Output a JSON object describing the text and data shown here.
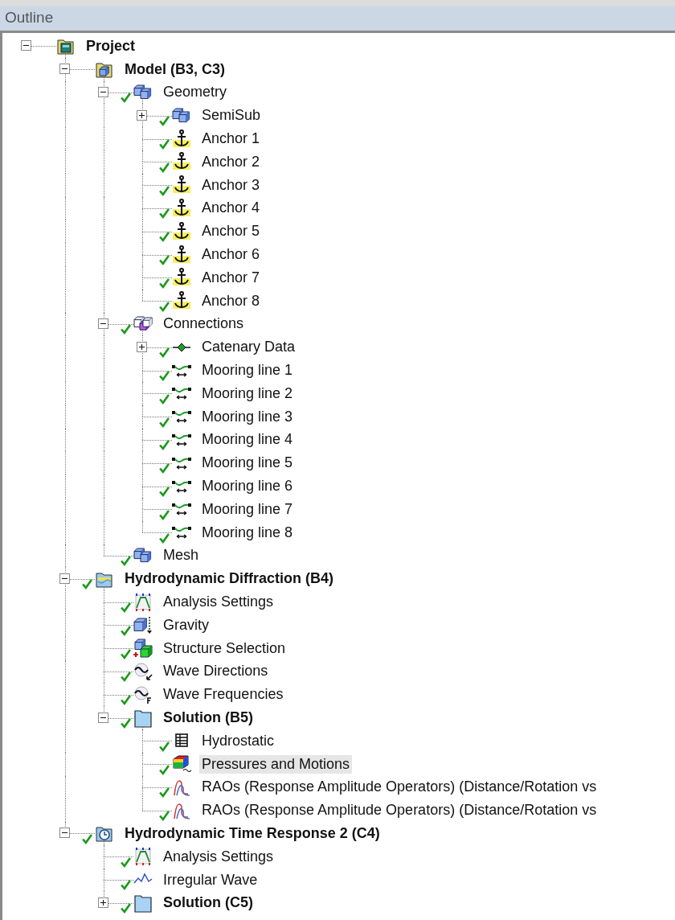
{
  "panel": {
    "title": "Outline"
  },
  "tree": [
    {
      "label": "Project",
      "kind": "project",
      "bold": true,
      "checked": false,
      "selected": false,
      "expanded": true,
      "children": [
        {
          "label": "Model (B3, C3)",
          "kind": "model",
          "bold": true,
          "checked": false,
          "selected": false,
          "expanded": true,
          "children": [
            {
              "label": "Geometry",
              "kind": "geometry",
              "bold": false,
              "checked": true,
              "selected": false,
              "expanded": true,
              "children": [
                {
                  "label": "SemiSub",
                  "kind": "geometry",
                  "bold": false,
                  "checked": true,
                  "selected": false,
                  "expanded": false
                },
                {
                  "label": "Anchor 1",
                  "kind": "anchor",
                  "bold": false,
                  "checked": true,
                  "selected": false
                },
                {
                  "label": "Anchor 2",
                  "kind": "anchor",
                  "bold": false,
                  "checked": true,
                  "selected": false
                },
                {
                  "label": "Anchor 3",
                  "kind": "anchor",
                  "bold": false,
                  "checked": true,
                  "selected": false
                },
                {
                  "label": "Anchor 4",
                  "kind": "anchor",
                  "bold": false,
                  "checked": true,
                  "selected": false
                },
                {
                  "label": "Anchor 5",
                  "kind": "anchor",
                  "bold": false,
                  "checked": true,
                  "selected": false
                },
                {
                  "label": "Anchor 6",
                  "kind": "anchor",
                  "bold": false,
                  "checked": true,
                  "selected": false
                },
                {
                  "label": "Anchor 7",
                  "kind": "anchor",
                  "bold": false,
                  "checked": true,
                  "selected": false
                },
                {
                  "label": "Anchor 8",
                  "kind": "anchor",
                  "bold": false,
                  "checked": true,
                  "selected": false
                }
              ]
            },
            {
              "label": "Connections",
              "kind": "connections",
              "bold": false,
              "checked": true,
              "selected": false,
              "expanded": true,
              "children": [
                {
                  "label": "Catenary Data",
                  "kind": "catenary",
                  "bold": false,
                  "checked": true,
                  "selected": false,
                  "expanded": false
                },
                {
                  "label": "Mooring line 1",
                  "kind": "mooring",
                  "bold": false,
                  "checked": true,
                  "selected": false
                },
                {
                  "label": "Mooring line 2",
                  "kind": "mooring",
                  "bold": false,
                  "checked": true,
                  "selected": false
                },
                {
                  "label": "Mooring line 3",
                  "kind": "mooring",
                  "bold": false,
                  "checked": true,
                  "selected": false
                },
                {
                  "label": "Mooring line 4",
                  "kind": "mooring",
                  "bold": false,
                  "checked": true,
                  "selected": false
                },
                {
                  "label": "Mooring line 5",
                  "kind": "mooring",
                  "bold": false,
                  "checked": true,
                  "selected": false
                },
                {
                  "label": "Mooring line 6",
                  "kind": "mooring",
                  "bold": false,
                  "checked": true,
                  "selected": false
                },
                {
                  "label": "Mooring line 7",
                  "kind": "mooring",
                  "bold": false,
                  "checked": true,
                  "selected": false
                },
                {
                  "label": "Mooring line 8",
                  "kind": "mooring",
                  "bold": false,
                  "checked": true,
                  "selected": false
                }
              ]
            },
            {
              "label": "Mesh",
              "kind": "geometry",
              "bold": false,
              "checked": true,
              "selected": false
            }
          ]
        },
        {
          "label": "Hydrodynamic Diffraction (B4)",
          "kind": "diffraction",
          "bold": true,
          "checked": true,
          "selected": false,
          "expanded": true,
          "children": [
            {
              "label": "Analysis Settings",
              "kind": "analysis",
              "bold": false,
              "checked": true,
              "selected": false
            },
            {
              "label": "Gravity",
              "kind": "gravity",
              "bold": false,
              "checked": true,
              "selected": false
            },
            {
              "label": "Structure Selection",
              "kind": "structure",
              "bold": false,
              "checked": true,
              "selected": false
            },
            {
              "label": "Wave Directions",
              "kind": "wave-dir",
              "bold": false,
              "checked": true,
              "selected": false
            },
            {
              "label": "Wave Frequencies",
              "kind": "wave-freq",
              "bold": false,
              "checked": true,
              "selected": false
            },
            {
              "label": "Solution (B5)",
              "kind": "solution",
              "bold": true,
              "checked": true,
              "selected": false,
              "expanded": true,
              "children": [
                {
                  "label": "Hydrostatic",
                  "kind": "table",
                  "bold": false,
                  "checked": true,
                  "selected": false
                },
                {
                  "label": "Pressures and Motions",
                  "kind": "pressures",
                  "bold": false,
                  "checked": true,
                  "selected": true
                },
                {
                  "label": "RAOs (Response Amplitude Operators) (Distance/Rotation vs",
                  "kind": "rao",
                  "bold": false,
                  "checked": true,
                  "selected": false
                },
                {
                  "label": "RAOs (Response Amplitude Operators) (Distance/Rotation vs",
                  "kind": "rao",
                  "bold": false,
                  "checked": true,
                  "selected": false
                }
              ]
            }
          ]
        },
        {
          "label": "Hydrodynamic Time Response 2 (C4)",
          "kind": "time-response",
          "bold": true,
          "checked": true,
          "selected": false,
          "expanded": true,
          "children": [
            {
              "label": "Analysis Settings",
              "kind": "analysis",
              "bold": false,
              "checked": true,
              "selected": false
            },
            {
              "label": "Irregular Wave",
              "kind": "irregular-wave",
              "bold": false,
              "checked": true,
              "selected": false
            },
            {
              "label": "Solution (C5)",
              "kind": "solution",
              "bold": true,
              "checked": true,
              "selected": false,
              "expanded": false
            }
          ]
        }
      ]
    }
  ]
}
